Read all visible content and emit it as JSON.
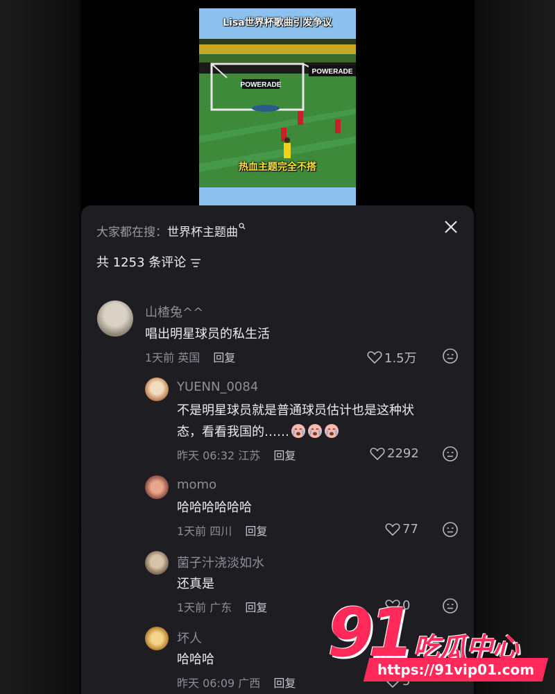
{
  "video": {
    "title": "Lisa世界杯歌曲引发争议",
    "caption": "热血主题完全不搭",
    "ad_text": "POWERADE"
  },
  "sheet": {
    "search_prefix": "大家都在搜：",
    "search_term": "世界杯主题曲",
    "count_text": "共 1253 条评论"
  },
  "comments": [
    {
      "user": "山楂兔^^",
      "text": "唱出明星球员的私生活",
      "time": "1天前",
      "location": "英国",
      "reply": "回复",
      "likes": "1.5万"
    },
    {
      "user": "YUENN_0084",
      "text_line1": "不是明星球员就是普通球员估计也是这种状",
      "text_line2": "态，看看我国的……",
      "time": "昨天 06:32",
      "location": "江苏",
      "reply": "回复",
      "likes": "2292"
    },
    {
      "user": "momo",
      "text": "哈哈哈哈哈哈",
      "time": "1天前",
      "location": "四川",
      "reply": "回复",
      "likes": "77"
    },
    {
      "user": "菌子汁浇淡如水",
      "text": "还真是",
      "time": "1天前",
      "location": "广东",
      "reply": "回复",
      "likes": "0"
    },
    {
      "user": "坏人",
      "text": "哈哈哈",
      "time": "昨天 06:09",
      "location": "广西",
      "reply": "回复",
      "likes": "5"
    }
  ],
  "watermark": {
    "number": "91",
    "name": "吃瓜中心",
    "url": "https://91vip01.com"
  },
  "colors": {
    "sheet_bg": "#1d1d22",
    "watermark": "#ff2a5a"
  }
}
